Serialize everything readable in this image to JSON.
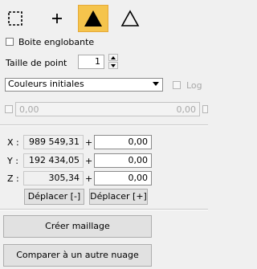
{
  "toolbar": {
    "tools": [
      {
        "icon": "dashed-rectangle-icon",
        "active": false
      },
      {
        "icon": "plus-icon",
        "active": false
      },
      {
        "icon": "filled-triangle-icon",
        "active": true
      },
      {
        "icon": "outline-triangle-icon",
        "active": false
      }
    ],
    "active_color": "#f5c44c"
  },
  "bounding_box": {
    "label": "Boite englobante",
    "checked": false
  },
  "point_size": {
    "label": "Taille de point",
    "value": "1"
  },
  "color_mode": {
    "selected": "Couleurs initiales",
    "log_label": "Log",
    "log_enabled": false
  },
  "range": {
    "min": "0,00",
    "max": "0,00",
    "enabled": false
  },
  "coords": {
    "x": {
      "label": "X :",
      "value": "989 549,31",
      "offset": "0,00"
    },
    "y": {
      "label": "Y :",
      "value": "192 434,05",
      "offset": "0,00"
    },
    "z": {
      "label": "Z :",
      "value": "305,34",
      "offset": "0,00"
    },
    "plus_sign": "+"
  },
  "move_buttons": {
    "minus": "Déplacer [-]",
    "plus": "Déplacer [+]"
  },
  "actions": {
    "create_mesh": "Créer maillage",
    "compare": "Comparer à un autre nuage"
  }
}
